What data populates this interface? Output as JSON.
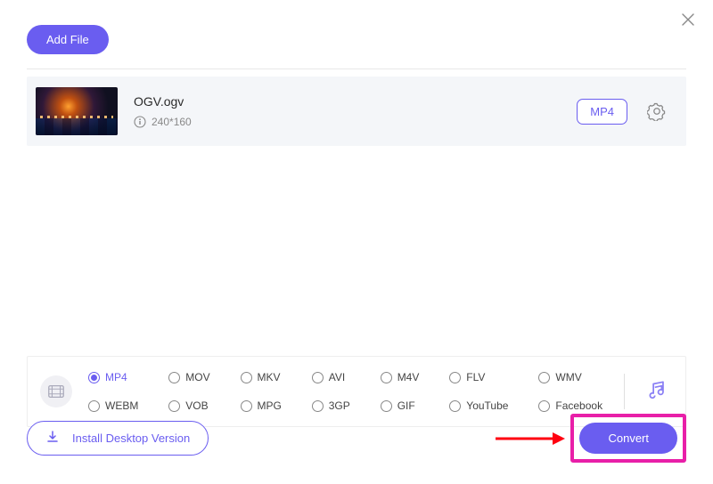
{
  "header": {
    "add_file_label": "Add File"
  },
  "file": {
    "name": "OGV.ogv",
    "resolution": "240*160",
    "target_format": "MP4"
  },
  "formats": {
    "row1": [
      "MP4",
      "MOV",
      "MKV",
      "AVI",
      "M4V",
      "FLV",
      "WMV"
    ],
    "row2": [
      "WEBM",
      "VOB",
      "MPG",
      "3GP",
      "GIF",
      "YouTube",
      "Facebook"
    ],
    "selected": "MP4"
  },
  "footer": {
    "install_label": "Install Desktop Version",
    "convert_label": "Convert"
  }
}
